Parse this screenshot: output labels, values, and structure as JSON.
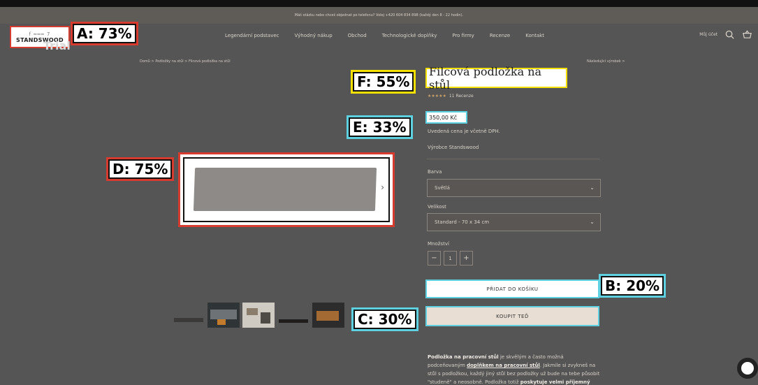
{
  "announcement": "Máš otázku nebo chceš objednat po telefonu? Volej +420 604 834 898 (každý den 8 - 22 hodin).",
  "brand": {
    "mark": "f ═══ 7",
    "name": "STANDSWOOD",
    "watermark": "Trial"
  },
  "nav": [
    "Legendární podstavec",
    "Výhodný nákup",
    "Obchod",
    "Technologické doplňky",
    "Pro firmy",
    "Recenze",
    "Kontakt"
  ],
  "header": {
    "account": "Můj účet"
  },
  "breadcrumb": "Domů  >  Podložky na stůl  >  Filcová podložka na stůl",
  "next_product": "Následující výrobek  >",
  "product": {
    "title": "Filcová podložka na stůl",
    "stars": "★★★★★",
    "reviews": "11 Recenze",
    "price": "350,00 Kč",
    "vat_note": "Uvedená cena je včetně DPH.",
    "maker": "Výrobce Standswood"
  },
  "options": {
    "color_label": "Barva",
    "color_value": "Světlá",
    "size_label": "Velikost",
    "size_value": "Standard - 70 x 34 cm",
    "qty_label": "Množství",
    "qty_value": "1",
    "minus": "−",
    "plus": "+"
  },
  "buttons": {
    "add_to_cart": "PŘIDAT DO KOŠÍKU",
    "buy_now": "KOUPIT TEĎ"
  },
  "description": {
    "part1": "Podložka na pracovní stůl",
    "part2": " je skvělým a často možná podceňovaným ",
    "part3": "doplňkem na pracovní stůl",
    "part4": ". Jakmile si zvykneš na stůl s podložkou, každý jiný stůl bez podložky už bude na tebe působit \"studeně\" a neosobně. Podložka totiž ",
    "part5": "poskytuje velmi příjemný komfort při práci"
  },
  "annotations": {
    "A": "A: 73%",
    "B": "B: 20%",
    "C": "C: 30%",
    "D": "D: 75%",
    "E": "E: 33%",
    "F": "F: 55%"
  },
  "colors": {
    "overlay": "#555555",
    "red": "#d63b2f",
    "yellow": "#f5e000",
    "cyan": "#5fd0e0",
    "buy_bg": "#e8ded4"
  }
}
